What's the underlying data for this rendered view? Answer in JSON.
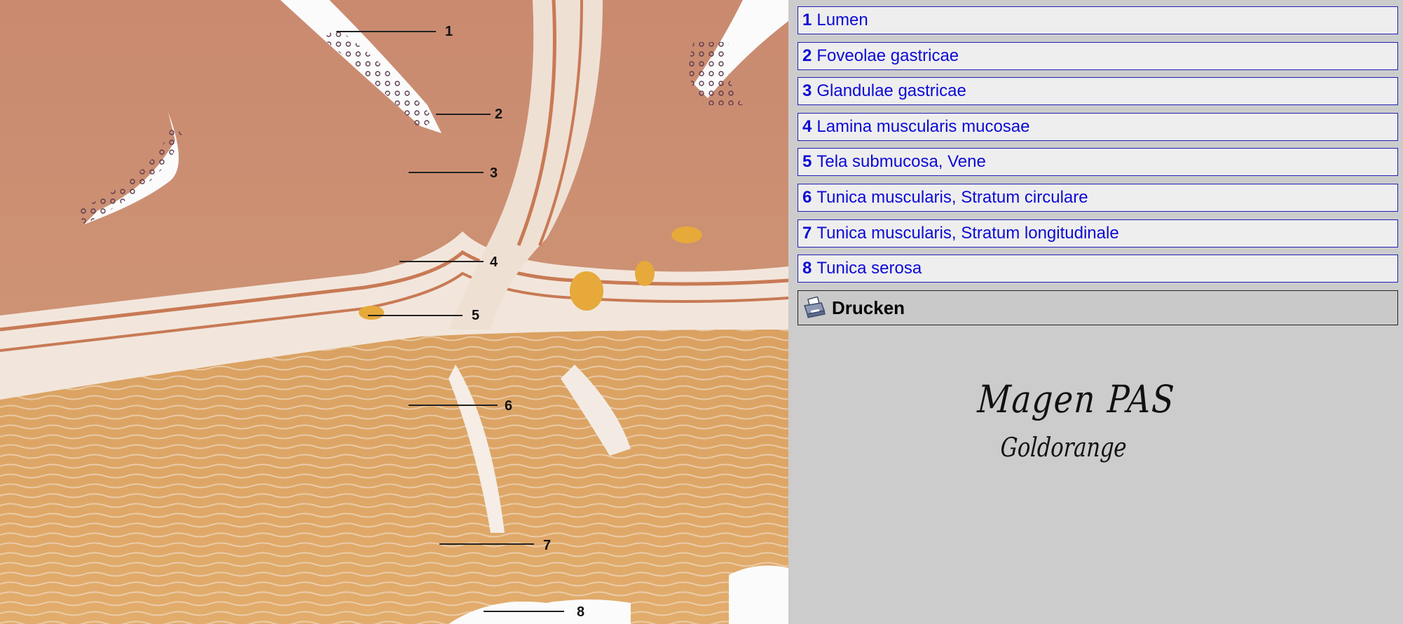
{
  "legend": {
    "items": [
      {
        "num": "1",
        "label": "Lumen"
      },
      {
        "num": "2",
        "label": "Foveolae gastricae"
      },
      {
        "num": "3",
        "label": "Glandulae gastricae"
      },
      {
        "num": "4",
        "label": "Lamina muscularis mucosae"
      },
      {
        "num": "5",
        "label": "Tela submucosa, Vene"
      },
      {
        "num": "6",
        "label": "Tunica muscularis, Stratum circulare"
      },
      {
        "num": "7",
        "label": "Tunica muscularis, Stratum longitudinale"
      },
      {
        "num": "8",
        "label": "Tunica serosa"
      }
    ]
  },
  "toolbar": {
    "print_label": "Drucken",
    "print_icon": "printer-icon"
  },
  "note": {
    "line1": "Magen PAS",
    "line2": "Goldorange"
  },
  "image": {
    "labels": [
      "1",
      "2",
      "3",
      "4",
      "5",
      "6",
      "7",
      "8"
    ]
  },
  "colors": {
    "link_text": "#0b0bd6",
    "item_border": "#1f1fb8",
    "item_bg": "#efeeee",
    "page_bg": "#cccccc"
  }
}
